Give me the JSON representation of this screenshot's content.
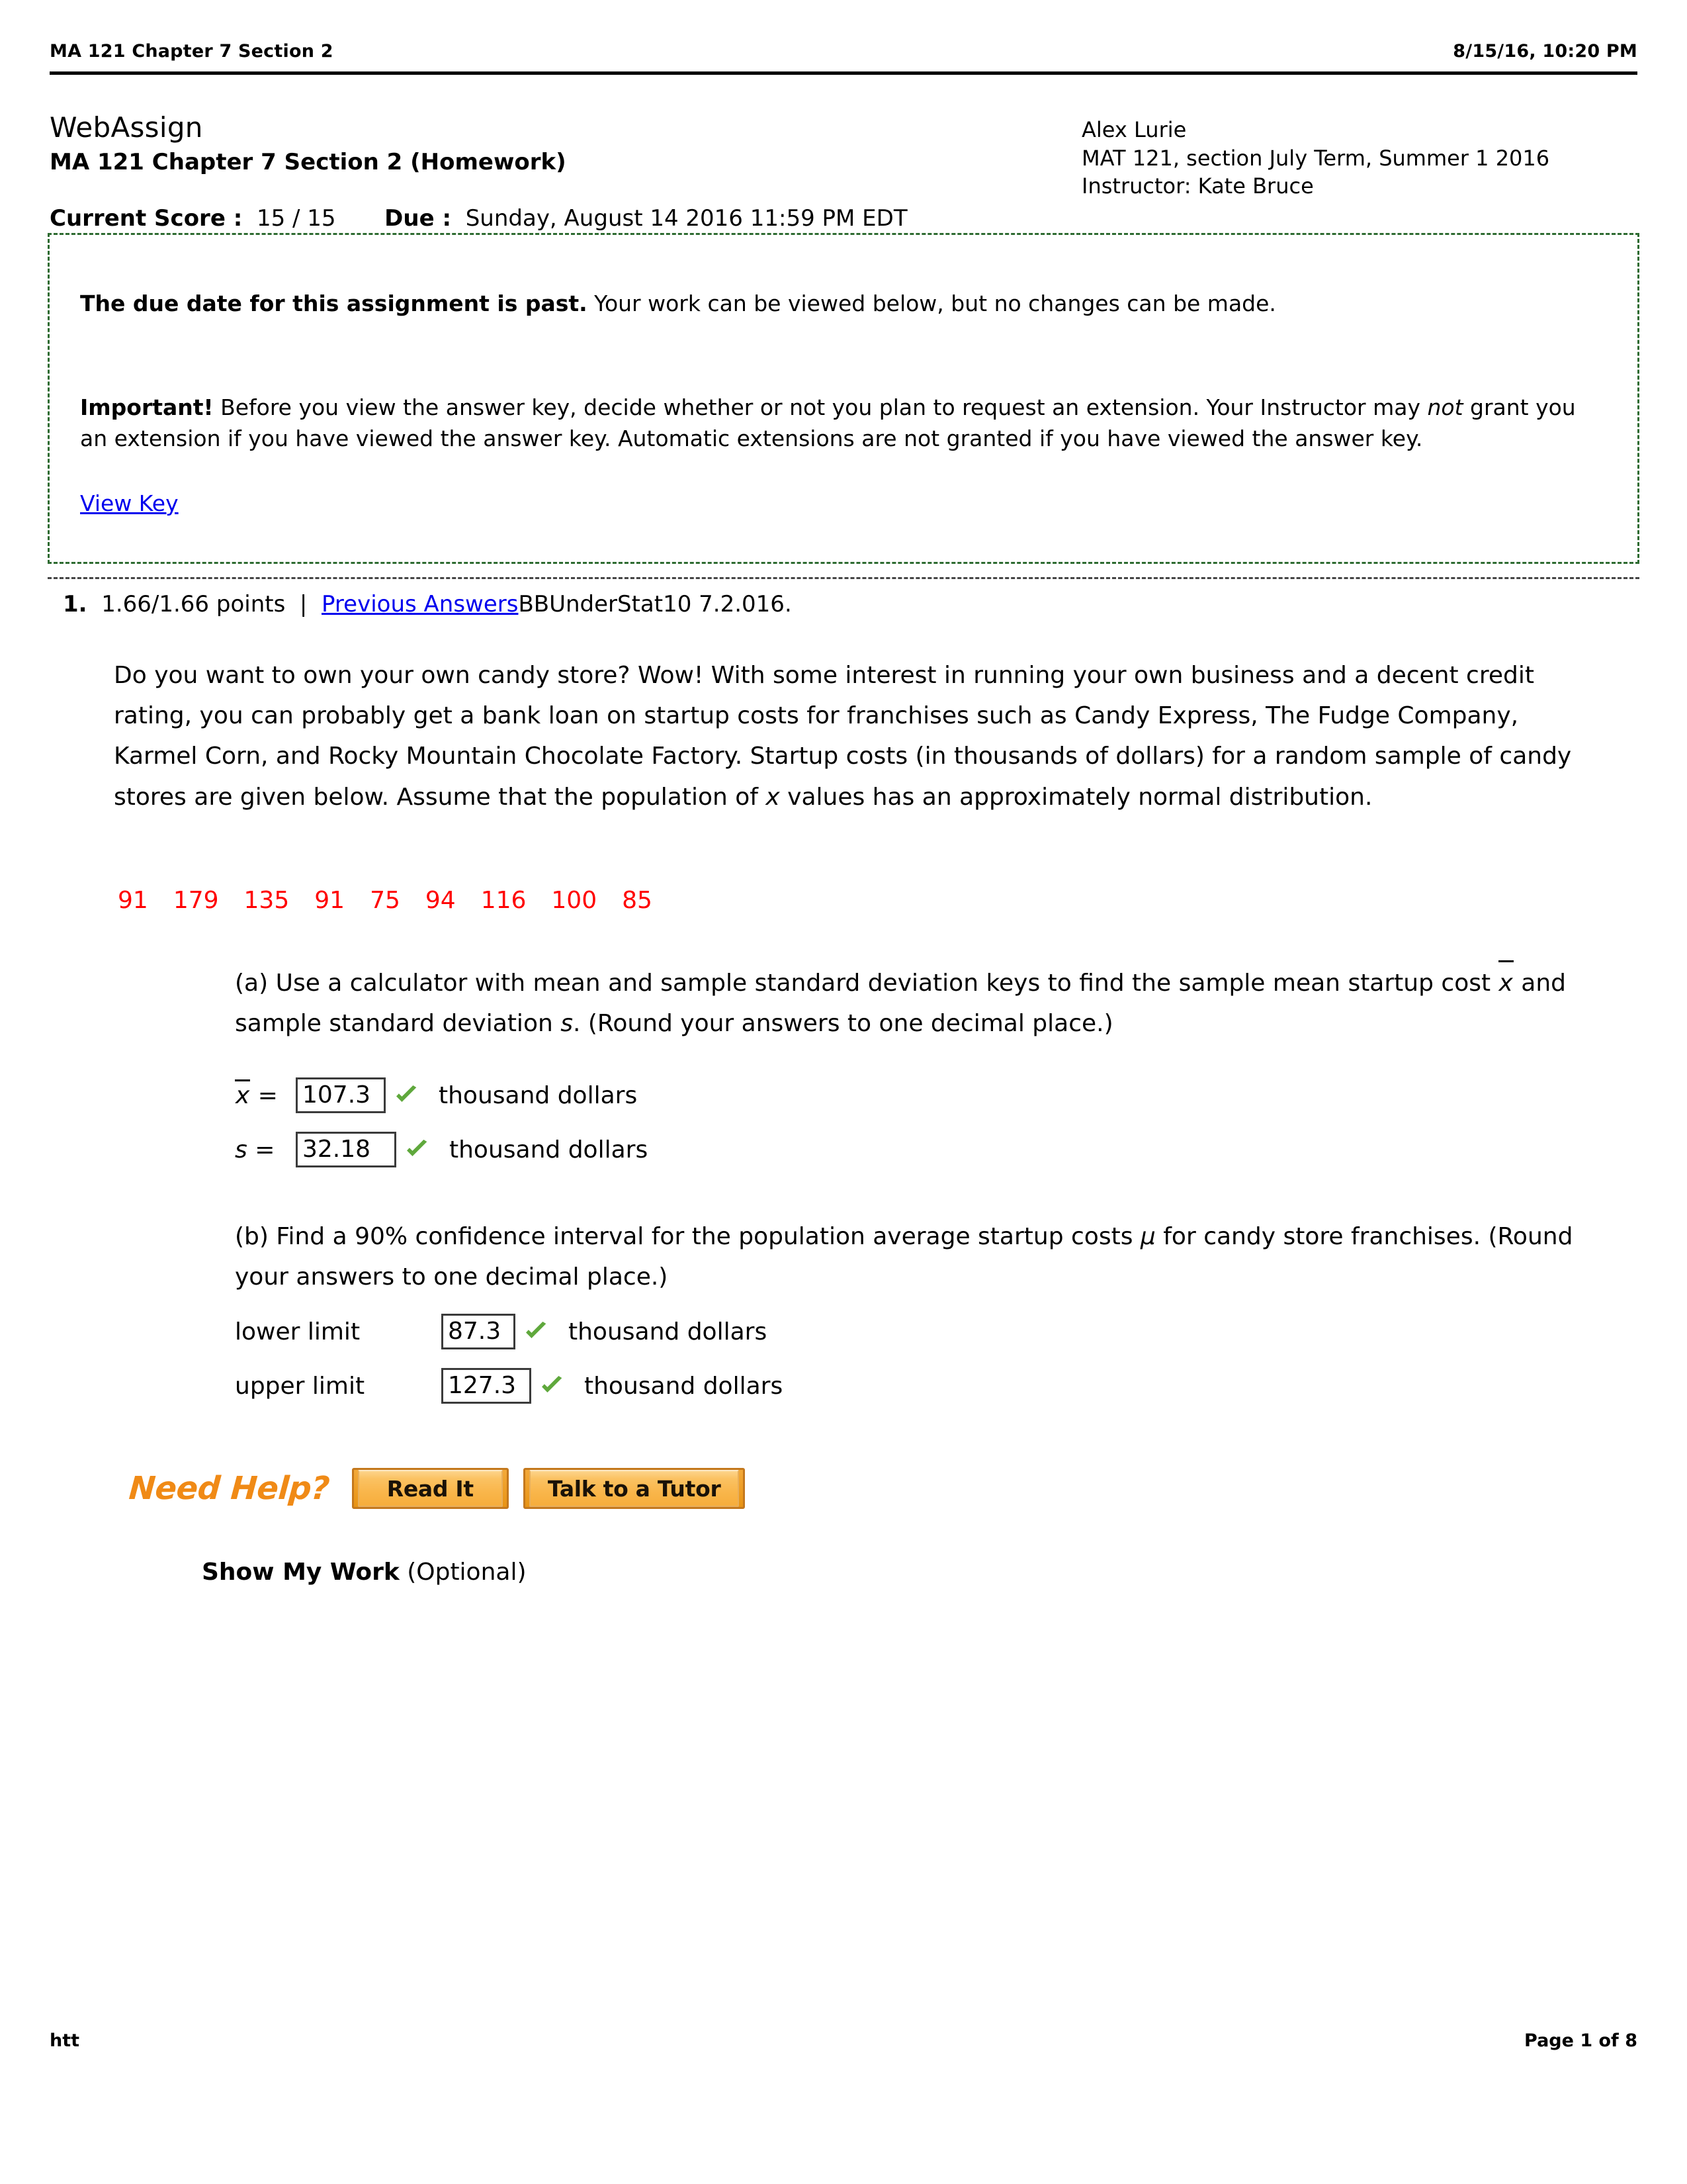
{
  "print_header": {
    "left": "MA 121 Chapter 7 Section 2",
    "right": "8/15/16, 10:20 PM"
  },
  "brand": {
    "name": "WebAssign",
    "assignment_title": "MA 121 Chapter 7 Section 2 (Homework)"
  },
  "student": {
    "name": "Alex Lurie",
    "course": "MAT 121, section July Term, Summer 1 2016",
    "instructor": "Instructor: Kate Bruce"
  },
  "score": {
    "score_label": "Current Score :",
    "score_value": "15 / 15",
    "due_label": "Due :",
    "due_value": "Sunday, August 14 2016 11:59 PM EDT"
  },
  "notice": {
    "border_color": "#2e6b31",
    "past_due_bold": "The due date for this assignment is past.",
    "past_due_rest": " Your work can be viewed below, but no changes can be made.",
    "important_bold": "Important!",
    "important_1": " Before you view the answer key, decide whether or not you plan to request an extension. Your Instructor may ",
    "important_italic": "not",
    "important_2": " grant you an extension if you have viewed the answer key. Automatic extensions are not granted if you have viewed the answer key.",
    "view_key_link": "View Key"
  },
  "question": {
    "number": "1.",
    "points": "1.66/1.66 points",
    "separator": "|",
    "previous_answers_link": "Previous Answers",
    "problem_code": "BBUnderStat10 7.2.016.",
    "body_1": "Do you want to own your own candy store? Wow! With some interest in running your own business and a decent credit rating, you can probably get a bank loan on startup costs for franchises such as Candy Express, The Fudge Company, Karmel Corn, and Rocky Mountain Chocolate Factory. Startup costs (in thousands of dollars) for a random sample of candy stores are given below. Assume that the population of ",
    "body_var": "x",
    "body_2": " values has an approximately normal distribution.",
    "data_color": "#ff0000",
    "data_values": [
      "91",
      "179",
      "135",
      "91",
      "75",
      "94",
      "116",
      "100",
      "85"
    ],
    "part_a": {
      "text_1": "(a) Use a calculator with mean and sample standard deviation keys to find the sample mean startup cost ",
      "xbar_symbol": "x",
      "text_2": " and sample standard deviation ",
      "s_symbol": "s",
      "text_3": ". (Round your answers to one decimal place.)",
      "rows": [
        {
          "label_symbol": "x",
          "label_overbar": true,
          "label_eq": " = ",
          "value": "107.3",
          "units": "thousand dollars",
          "status": "correct"
        },
        {
          "label_symbol": "s",
          "label_overbar": false,
          "label_eq": " = ",
          "value": "32.18",
          "units": "thousand dollars",
          "status": "correct"
        }
      ]
    },
    "part_b": {
      "text_1": "(b) Find a 90% confidence interval for the population average startup costs ",
      "mu_symbol": "μ",
      "text_2": " for candy store franchises. (Round your answers to one decimal place.)",
      "rows": [
        {
          "label": "lower limit",
          "value": "87.3",
          "units": "thousand dollars",
          "status": "correct"
        },
        {
          "label": "upper limit",
          "value": "127.3",
          "units": "thousand dollars",
          "status": "correct"
        }
      ]
    }
  },
  "need_help": {
    "title": "Need Help?",
    "title_color": "#f08a16",
    "buttons": [
      {
        "label": "Read It"
      },
      {
        "label": "Talk to a Tutor"
      }
    ]
  },
  "show_my_work": {
    "bold": "Show My Work",
    "rest": " (Optional)"
  },
  "print_footer": {
    "left": "htt",
    "right": "Page 1 of 8"
  }
}
